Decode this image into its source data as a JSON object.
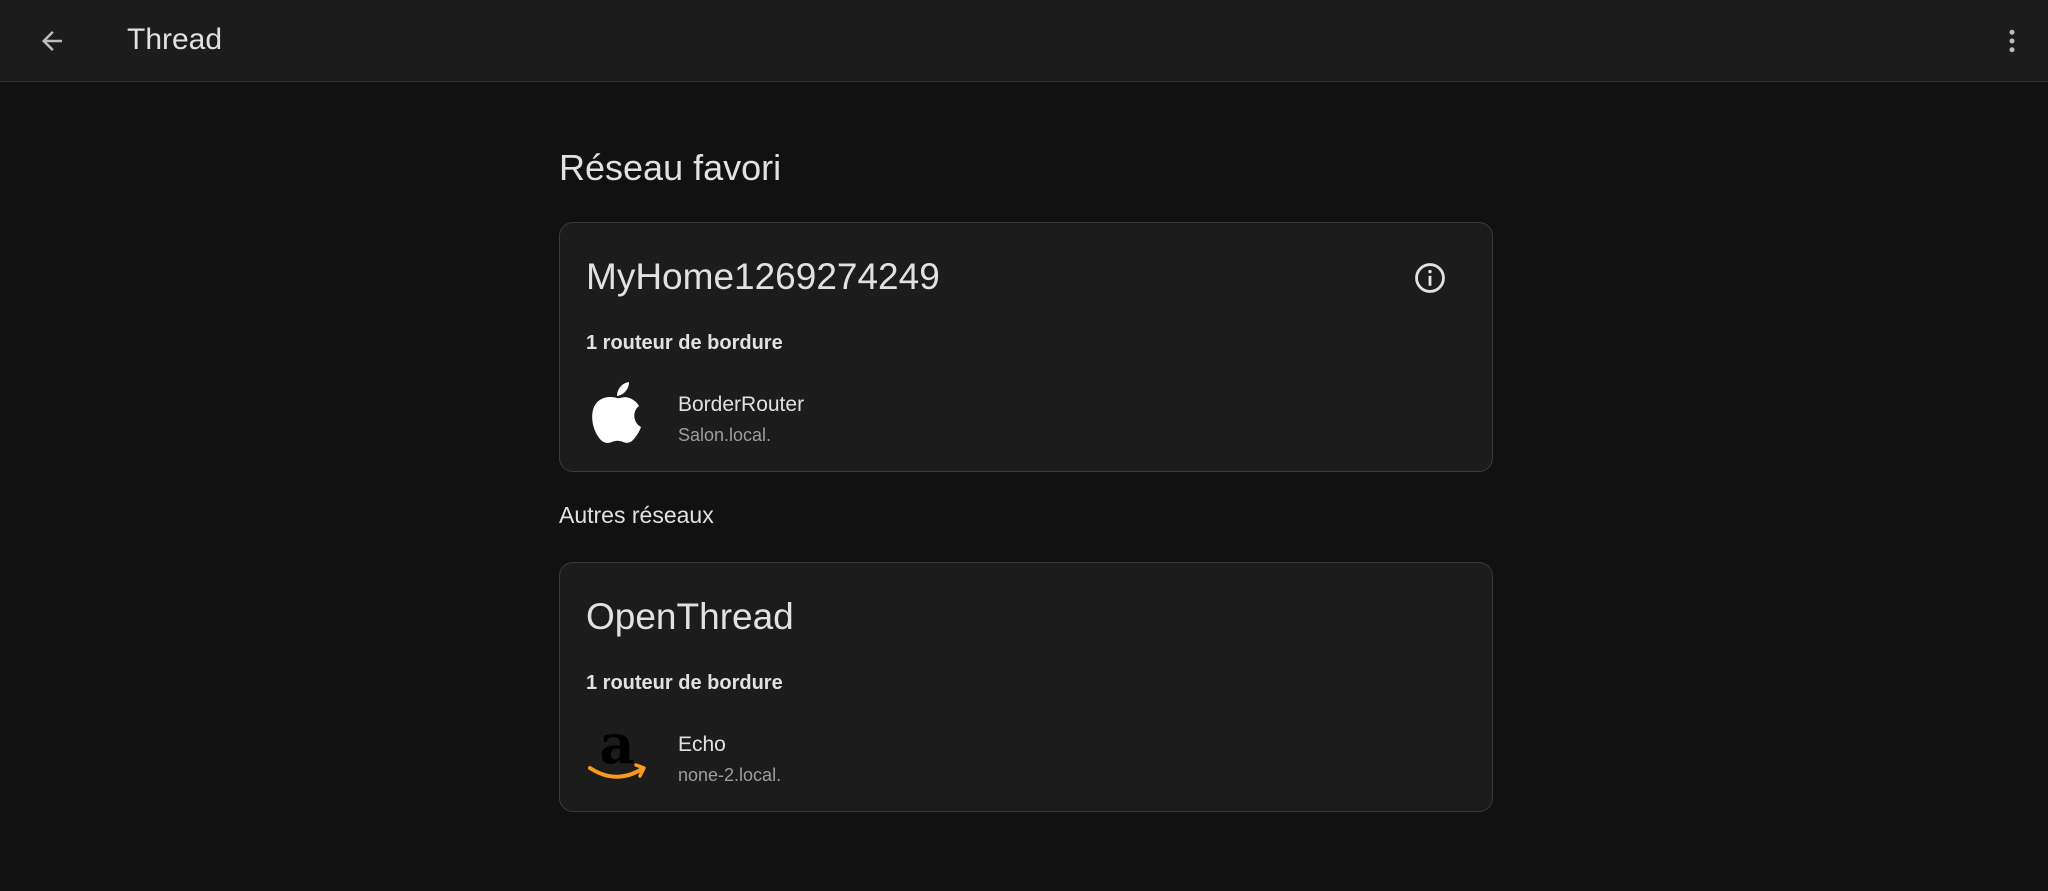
{
  "app_bar": {
    "title": "Thread",
    "back_icon": "arrow-back-icon",
    "menu_icon": "more-vert-icon"
  },
  "preferred": {
    "heading": "Réseau favori",
    "network": {
      "name": "MyHome1269274249",
      "info_icon": "info-icon",
      "router_count": "1 routeur de bordure",
      "router": {
        "name": "BorderRouter",
        "host": "Salon.local.",
        "logo": "apple-logo"
      }
    }
  },
  "others": {
    "heading": "Autres réseaux",
    "network": {
      "name": "OpenThread",
      "router_count": "1 routeur de bordure",
      "router": {
        "name": "Echo",
        "host": "none-2.local.",
        "logo": "amazon-logo"
      }
    }
  },
  "colors": {
    "background": "#111111",
    "surface": "#1c1c1c",
    "text_primary": "#e1e1e1",
    "text_secondary": "#9e9e9e",
    "amazon_smile": "#f79a1d"
  }
}
